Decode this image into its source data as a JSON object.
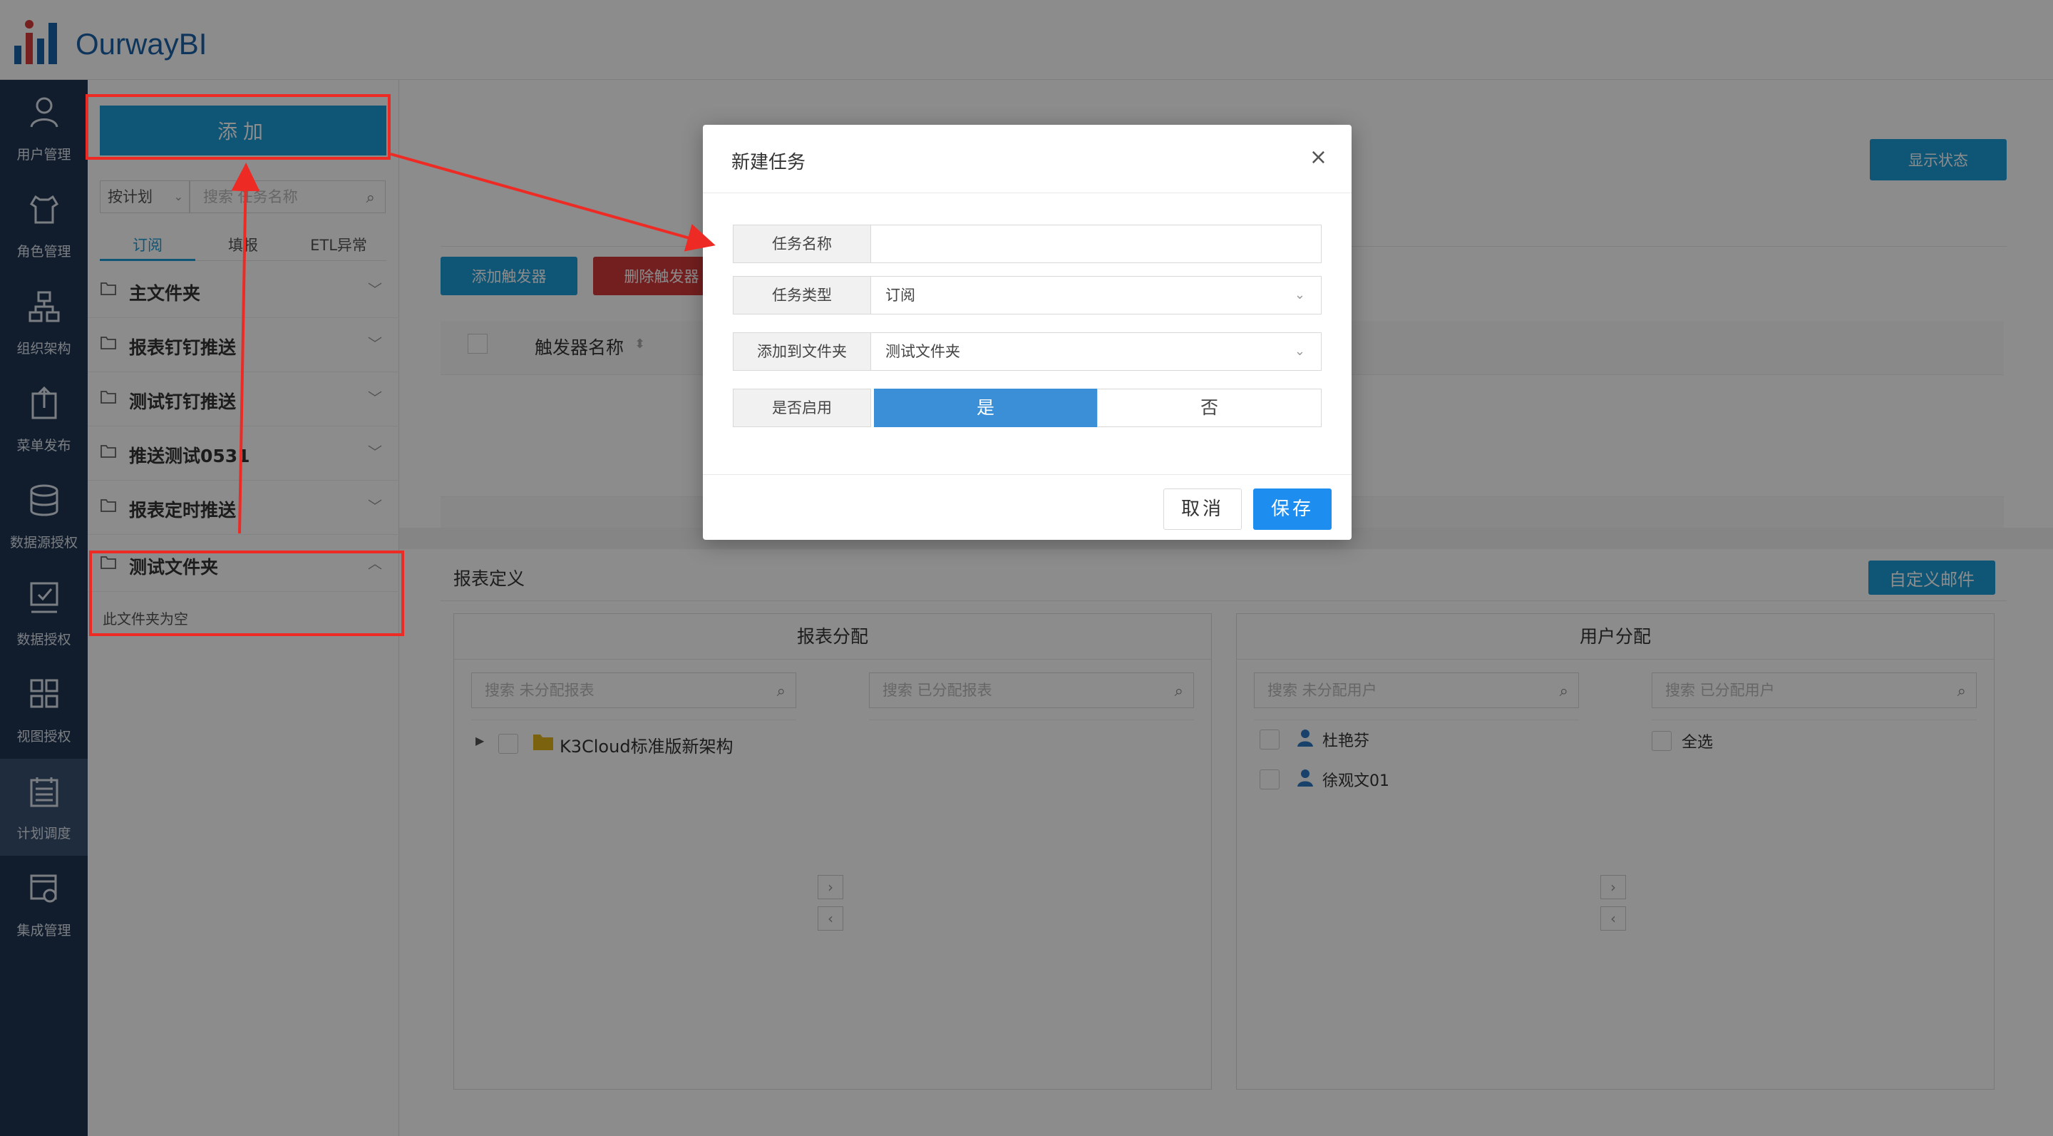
{
  "app": {
    "logo_text": "OurwayBI"
  },
  "nav": {
    "items": [
      {
        "label": "用户管理",
        "icon": "user-icon"
      },
      {
        "label": "角色管理",
        "icon": "role-shirt-icon"
      },
      {
        "label": "组织架构",
        "icon": "org-chart-icon"
      },
      {
        "label": "菜单发布",
        "icon": "publish-icon"
      },
      {
        "label": "数据源授权",
        "icon": "database-icon"
      },
      {
        "label": "数据授权",
        "icon": "data-auth-icon"
      },
      {
        "label": "视图授权",
        "icon": "view-grid-icon"
      },
      {
        "label": "计划调度",
        "icon": "schedule-icon"
      },
      {
        "label": "集成管理",
        "icon": "integration-icon"
      }
    ],
    "active_index": 7
  },
  "tree": {
    "add_label": "添加",
    "filter_value": "按计划",
    "search_placeholder": "搜索 任务名称",
    "tabs": [
      "订阅",
      "填报",
      "ETL异常"
    ],
    "active_tab": 0,
    "folders": [
      "主文件夹",
      "报表钉钉推送",
      "测试钉钉推送",
      "推送测试0531",
      "报表定时推送",
      "测试文件夹"
    ],
    "empty_note": "此文件夹为空"
  },
  "main": {
    "status_btn": "显示状态",
    "add_trigger": "添加触发器",
    "del_trigger": "删除触发器",
    "trigger_col": "触发器名称",
    "report_def_title": "报表定义",
    "custom_mail": "自定义邮件",
    "report_assign": {
      "title": "报表分配",
      "left_placeholder": "搜索 未分配报表",
      "right_placeholder": "搜索 已分配报表",
      "items": [
        "K3Cloud标准版新架构"
      ]
    },
    "user_assign": {
      "title": "用户分配",
      "left_placeholder": "搜索 未分配用户",
      "right_placeholder": "搜索 已分配用户",
      "users": [
        "杜艳芬",
        "徐观文01"
      ],
      "select_all": "全选"
    }
  },
  "modal": {
    "title": "新建任务",
    "fields": {
      "name_label": "任务名称",
      "name_value": "",
      "type_label": "任务类型",
      "type_value": "订阅",
      "folder_label": "添加到文件夹",
      "folder_value": "测试文件夹",
      "enable_label": "是否启用",
      "yes": "是",
      "no": "否"
    },
    "cancel": "取消",
    "save": "保存"
  },
  "colors": {
    "accent": "#1a9bd7",
    "danger": "#d43a3a",
    "nav_bg": "#1f3552",
    "annotation": "#ee2a24"
  }
}
